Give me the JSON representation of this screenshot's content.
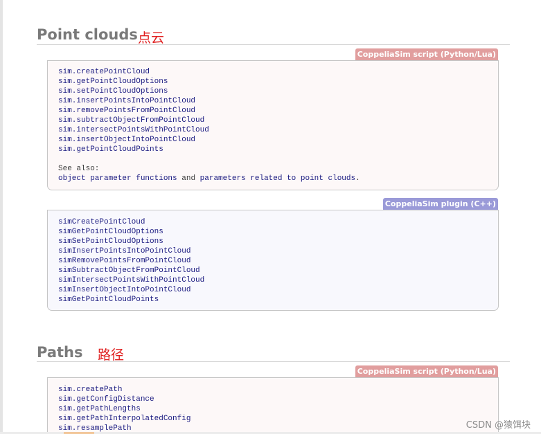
{
  "sections": {
    "point_clouds": {
      "title": "Point clouds",
      "title_cn": "点云",
      "script_box": {
        "badge": "CoppeliaSim script (Python/Lua)",
        "functions": [
          "sim.createPointCloud",
          "sim.getPointCloudOptions",
          "sim.setPointCloudOptions",
          "sim.insertPointsIntoPointCloud",
          "sim.removePointsFromPointCloud",
          "sim.subtractObjectFromPointCloud",
          "sim.intersectPointsWithPointCloud",
          "sim.insertObjectIntoPointCloud",
          "sim.getPointCloudPoints"
        ],
        "see_also_label": "See also:",
        "see_also_link1": "object parameter functions",
        "see_also_and": " and ",
        "see_also_link2": "parameters related to point clouds",
        "see_also_end": "."
      },
      "plugin_box": {
        "badge": "CoppeliaSim plugin (C++)",
        "functions": [
          "simCreatePointCloud",
          "simGetPointCloudOptions",
          "simSetPointCloudOptions",
          "simInsertPointsIntoPointCloud",
          "simRemovePointsFromPointCloud",
          "simSubtractObjectFromPointCloud",
          "simIntersectPointsWithPointCloud",
          "simInsertObjectIntoPointCloud",
          "simGetPointCloudPoints"
        ]
      }
    },
    "paths": {
      "title": "Paths",
      "title_cn": "路径",
      "script_box": {
        "badge": "CoppeliaSim script (Python/Lua)",
        "functions": [
          "sim.createPath",
          "sim.getConfigDistance",
          "sim.getPathLengths",
          "sim.getPathInterpolatedConfig",
          "sim.resamplePath"
        ]
      }
    }
  },
  "watermark": "CSDN @猿饵块",
  "colors": {
    "script_badge": "#e19e9e",
    "plugin_badge": "#9a9ad8",
    "code_text": "#1a1a80",
    "cn_title": "#e02020"
  }
}
